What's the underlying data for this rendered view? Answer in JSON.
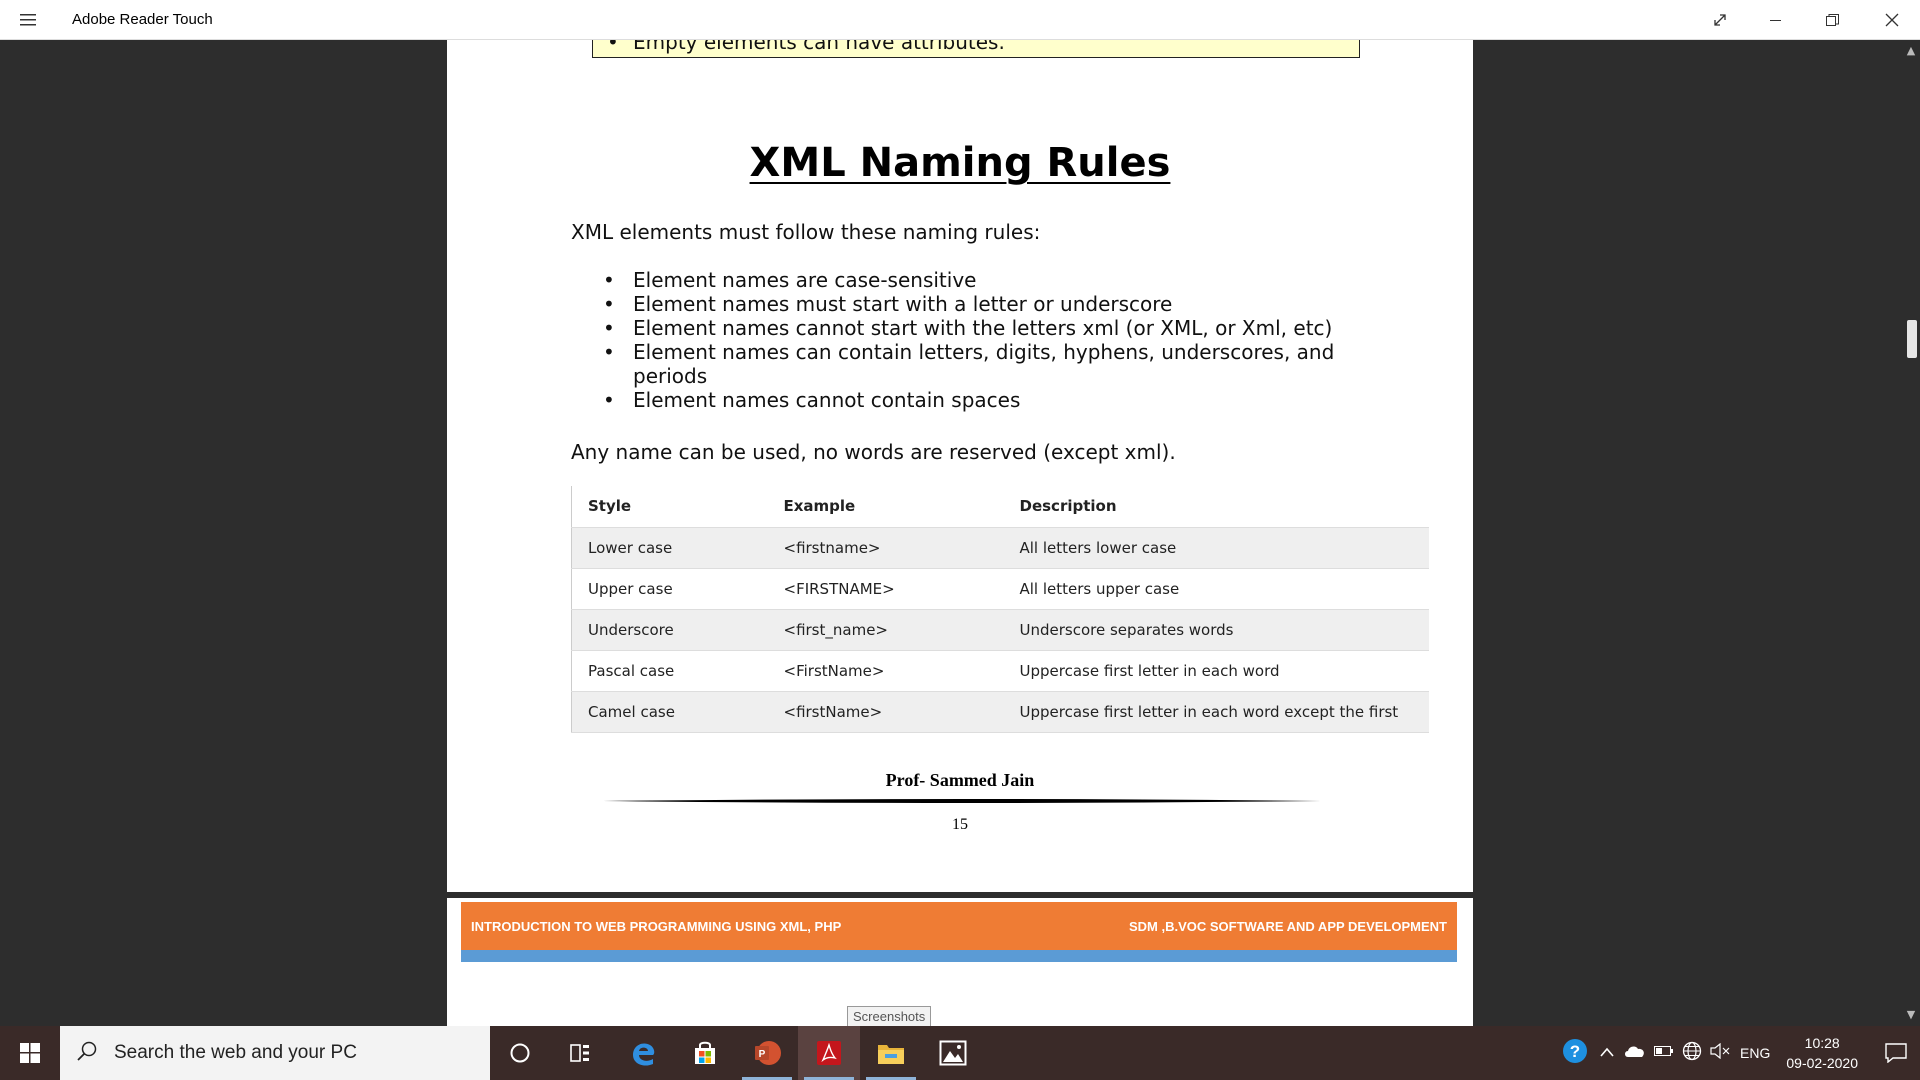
{
  "window": {
    "title": "Adobe Reader Touch"
  },
  "document": {
    "prev_box_text": "Empty elements can have attributes.",
    "heading": "XML Naming Rules",
    "intro": "XML elements must follow these naming rules:",
    "rules": [
      "Element names are case-sensitive",
      "Element names must start with a letter or underscore",
      "Element names cannot start with the letters xml (or XML, or Xml, etc)",
      "Element names can contain letters, digits, hyphens, underscores, and periods",
      "Element names cannot contain spaces"
    ],
    "note": "Any name can be used, no words are reserved (except xml).",
    "table": {
      "headers": [
        "Style",
        "Example",
        "Description"
      ],
      "rows": [
        [
          "Lower case",
          "<firstname>",
          "All letters lower case"
        ],
        [
          "Upper case",
          "<FIRSTNAME>",
          "All letters upper case"
        ],
        [
          "Underscore",
          "<first_name>",
          "Underscore separates words"
        ],
        [
          "Pascal case",
          "<FirstName>",
          "Uppercase first letter in each word"
        ],
        [
          "Camel case",
          "<firstName>",
          "Uppercase first letter in each word except the first"
        ]
      ]
    },
    "footer_name": "Prof- Sammed Jain",
    "page_number": "15",
    "banner_left": "INTRODUCTION TO  WEB PROGRAMMING USING XML, PHP",
    "banner_right": "SDM ,B.VOC  SOFTWARE AND APP DEVELOPMENT"
  },
  "tooltip": "Screenshots",
  "taskbar": {
    "search_placeholder": "Search the web and your PC",
    "apps": [
      "cortana-icon",
      "task-view-icon",
      "edge-icon",
      "store-icon",
      "powerpoint-icon",
      "adobe-reader-icon",
      "file-explorer-icon",
      "photos-icon"
    ],
    "language": "ENG",
    "time": "10:28",
    "date": "09-02-2020"
  },
  "colors": {
    "banner_orange": "#ef7c34",
    "banner_blue": "#5b9bd5",
    "prev_box_bg": "#ffffcc",
    "taskbar": "#3a2a28"
  }
}
